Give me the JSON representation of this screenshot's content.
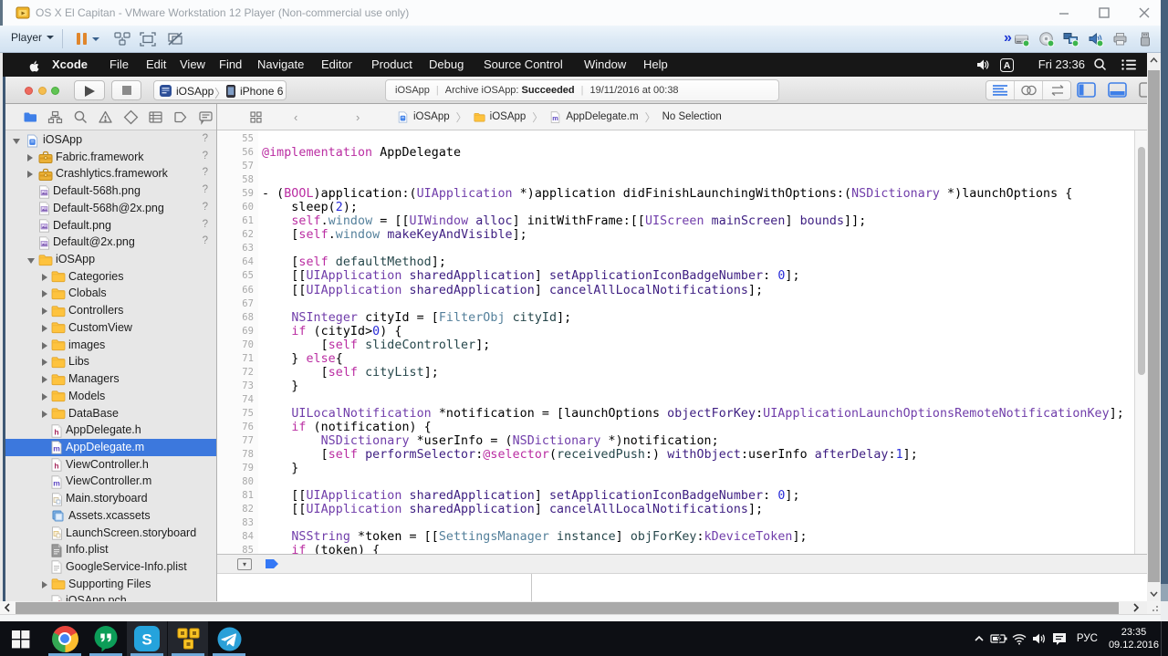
{
  "vmware": {
    "title": "OS X El Capitan - VMware Workstation 12 Player (Non-commercial use only)",
    "window_buttons": {
      "minimize": "–",
      "maximize": "",
      "close": "✕"
    },
    "player_menu_label": "Player",
    "toolbar_icons": [
      "pause",
      "ctrl-alt-del",
      "fullscreen",
      "unity"
    ],
    "overflow_chevrons": "»",
    "device_icons": [
      {
        "name": "hard-disk",
        "connected": true
      },
      {
        "name": "cd-rom",
        "connected": true
      },
      {
        "name": "network",
        "connected": true
      },
      {
        "name": "sound",
        "connected": true
      },
      {
        "name": "printer",
        "connected": false
      },
      {
        "name": "usb",
        "connected": false
      }
    ]
  },
  "macos": {
    "menus": [
      "Xcode",
      "File",
      "Edit",
      "View",
      "Find",
      "Navigate",
      "Editor",
      "Product",
      "Debug",
      "Source Control",
      "Window",
      "Help"
    ],
    "menu_extras": {
      "input_source": "A",
      "clock": "Fri 23:36"
    }
  },
  "xcode": {
    "toolbar": {
      "scheme": "iOSApp",
      "run_destination": "iPhone 6",
      "status_project": "iOSApp",
      "status_action": "Archive iOSApp:",
      "status_result": "Succeeded",
      "status_sep": "|",
      "status_date": "19/11/2016 at 00:38"
    },
    "navigator_tabs": [
      "project",
      "symbols",
      "search",
      "issues",
      "tests",
      "debug",
      "breakpoints",
      "reports"
    ],
    "navigator_items": [
      {
        "level": 0,
        "icon": "project",
        "label": "iOSApp",
        "badge": "?",
        "disclosure": "open"
      },
      {
        "level": 1,
        "icon": "framework",
        "label": "Fabric.framework",
        "badge": "?",
        "disclosure": "closed"
      },
      {
        "level": 1,
        "icon": "framework",
        "label": "Crashlytics.framework",
        "badge": "?",
        "disclosure": "closed"
      },
      {
        "level": 1,
        "icon": "png",
        "label": "Default-568h.png",
        "badge": "?"
      },
      {
        "level": 1,
        "icon": "png",
        "label": "Default-568h@2x.png",
        "badge": "?"
      },
      {
        "level": 1,
        "icon": "png",
        "label": "Default.png",
        "badge": "?"
      },
      {
        "level": 1,
        "icon": "png",
        "label": "Default@2x.png",
        "badge": "?"
      },
      {
        "level": 1,
        "icon": "folder",
        "label": "iOSApp",
        "disclosure": "open"
      },
      {
        "level": 2,
        "icon": "folder",
        "label": "Categories",
        "disclosure": "closed"
      },
      {
        "level": 2,
        "icon": "folder",
        "label": "Clobals",
        "disclosure": "closed"
      },
      {
        "level": 2,
        "icon": "folder",
        "label": "Controllers",
        "disclosure": "closed"
      },
      {
        "level": 2,
        "icon": "folder",
        "label": "CustomView",
        "disclosure": "closed"
      },
      {
        "level": 2,
        "icon": "folder",
        "label": "images",
        "disclosure": "closed"
      },
      {
        "level": 2,
        "icon": "folder",
        "label": "Libs",
        "disclosure": "closed"
      },
      {
        "level": 2,
        "icon": "folder",
        "label": "Managers",
        "disclosure": "closed"
      },
      {
        "level": 2,
        "icon": "folder",
        "label": "Models",
        "disclosure": "closed"
      },
      {
        "level": 2,
        "icon": "folder",
        "label": "DataBase",
        "disclosure": "closed"
      },
      {
        "level": 2,
        "icon": "file-h",
        "label": "AppDelegate.h"
      },
      {
        "level": 2,
        "icon": "file-m",
        "label": "AppDelegate.m",
        "selected": true
      },
      {
        "level": 2,
        "icon": "file-h",
        "label": "ViewController.h"
      },
      {
        "level": 2,
        "icon": "file-m",
        "label": "ViewController.m"
      },
      {
        "level": 2,
        "icon": "storyboard",
        "label": "Main.storyboard"
      },
      {
        "level": 2,
        "icon": "xcassets",
        "label": "Assets.xcassets"
      },
      {
        "level": 2,
        "icon": "storyboard2",
        "label": "LaunchScreen.storyboard"
      },
      {
        "level": 2,
        "icon": "plist",
        "label": "Info.plist"
      },
      {
        "level": 2,
        "icon": "plist2",
        "label": "GoogleService-Info.plist"
      },
      {
        "level": 2,
        "icon": "folder",
        "label": "Supporting Files",
        "disclosure": "closed"
      },
      {
        "level": 2,
        "icon": "pch",
        "label": "iOSApp.pch"
      }
    ],
    "jumpbar": {
      "crumbs": [
        {
          "icon": "project",
          "label": "iOSApp"
        },
        {
          "icon": "folder",
          "label": "iOSApp"
        },
        {
          "icon": "file-m",
          "label": "AppDelegate.m"
        },
        {
          "icon": null,
          "label": "No Selection"
        }
      ]
    },
    "editor_lines": [
      {
        "n": 55,
        "t": []
      },
      {
        "n": 56,
        "t": [
          [
            "k",
            "@implementation"
          ],
          [
            "p",
            " AppDelegate"
          ]
        ]
      },
      {
        "n": 57,
        "t": []
      },
      {
        "n": 58,
        "t": []
      },
      {
        "n": 59,
        "t": [
          [
            "p",
            "- ("
          ],
          [
            "k",
            "BOOL"
          ],
          [
            "p",
            ")application:("
          ],
          [
            "t",
            "UIApplication"
          ],
          [
            "p",
            " *)application didFinishLaunchingWithOptions:("
          ],
          [
            "t",
            "NSDictionary"
          ],
          [
            "p",
            " *)launchOptions {"
          ]
        ]
      },
      {
        "n": 60,
        "t": [
          [
            "p",
            "    sleep("
          ],
          [
            "n",
            "2"
          ],
          [
            "p",
            ");"
          ]
        ]
      },
      {
        "n": 61,
        "t": [
          [
            "p",
            "    "
          ],
          [
            "k",
            "self"
          ],
          [
            "p",
            "."
          ],
          [
            "w",
            "window"
          ],
          [
            "p",
            " = [["
          ],
          [
            "t",
            "UIWindow"
          ],
          [
            "p",
            " "
          ],
          [
            "m",
            "alloc"
          ],
          [
            "p",
            "] initWithFrame:[["
          ],
          [
            "t",
            "UIScreen"
          ],
          [
            "p",
            " "
          ],
          [
            "m",
            "mainScreen"
          ],
          [
            "p",
            "] "
          ],
          [
            "m",
            "bounds"
          ],
          [
            "p",
            "]];"
          ]
        ]
      },
      {
        "n": 62,
        "t": [
          [
            "p",
            "    ["
          ],
          [
            "k",
            "self"
          ],
          [
            "p",
            "."
          ],
          [
            "w",
            "window"
          ],
          [
            "p",
            " "
          ],
          [
            "m",
            "makeKeyAndVisible"
          ],
          [
            "p",
            "];"
          ]
        ]
      },
      {
        "n": 63,
        "t": []
      },
      {
        "n": 64,
        "t": [
          [
            "p",
            "    ["
          ],
          [
            "k",
            "self"
          ],
          [
            "p",
            " "
          ],
          [
            "f",
            "defaultMethod"
          ],
          [
            "p",
            "];"
          ]
        ]
      },
      {
        "n": 65,
        "t": [
          [
            "p",
            "    [["
          ],
          [
            "t",
            "UIApplication"
          ],
          [
            "p",
            " "
          ],
          [
            "m",
            "sharedApplication"
          ],
          [
            "p",
            "] "
          ],
          [
            "m",
            "setApplicationIconBadgeNumber"
          ],
          [
            "p",
            ": "
          ],
          [
            "n",
            "0"
          ],
          [
            "p",
            "];"
          ]
        ]
      },
      {
        "n": 66,
        "t": [
          [
            "p",
            "    [["
          ],
          [
            "t",
            "UIApplication"
          ],
          [
            "p",
            " "
          ],
          [
            "m",
            "sharedApplication"
          ],
          [
            "p",
            "] "
          ],
          [
            "m",
            "cancelAllLocalNotifications"
          ],
          [
            "p",
            "];"
          ]
        ]
      },
      {
        "n": 67,
        "t": []
      },
      {
        "n": 68,
        "t": [
          [
            "p",
            "    "
          ],
          [
            "t",
            "NSInteger"
          ],
          [
            "p",
            " cityId = ["
          ],
          [
            "c",
            "FilterObj"
          ],
          [
            "p",
            " "
          ],
          [
            "f",
            "cityId"
          ],
          [
            "p",
            "];"
          ]
        ]
      },
      {
        "n": 69,
        "t": [
          [
            "p",
            "    "
          ],
          [
            "k",
            "if"
          ],
          [
            "p",
            " (cityId>"
          ],
          [
            "n",
            "0"
          ],
          [
            "p",
            ") {"
          ]
        ]
      },
      {
        "n": 70,
        "t": [
          [
            "p",
            "        ["
          ],
          [
            "k",
            "self"
          ],
          [
            "p",
            " "
          ],
          [
            "f",
            "slideController"
          ],
          [
            "p",
            "];"
          ]
        ]
      },
      {
        "n": 71,
        "t": [
          [
            "p",
            "    } "
          ],
          [
            "k",
            "else"
          ],
          [
            "p",
            "{"
          ]
        ]
      },
      {
        "n": 72,
        "t": [
          [
            "p",
            "        ["
          ],
          [
            "k",
            "self"
          ],
          [
            "p",
            " "
          ],
          [
            "f",
            "cityList"
          ],
          [
            "p",
            "];"
          ]
        ]
      },
      {
        "n": 73,
        "t": [
          [
            "p",
            "    }"
          ]
        ]
      },
      {
        "n": 74,
        "t": []
      },
      {
        "n": 75,
        "t": [
          [
            "p",
            "    "
          ],
          [
            "t",
            "UILocalNotification"
          ],
          [
            "p",
            " *notification = [launchOptions "
          ],
          [
            "m",
            "objectForKey"
          ],
          [
            "p",
            ":"
          ],
          [
            "t",
            "UIApplicationLaunchOptionsRemoteNotificationKey"
          ],
          [
            "p",
            "];"
          ]
        ]
      },
      {
        "n": 76,
        "t": [
          [
            "p",
            "    "
          ],
          [
            "k",
            "if"
          ],
          [
            "p",
            " (notification) {"
          ]
        ]
      },
      {
        "n": 77,
        "t": [
          [
            "p",
            "        "
          ],
          [
            "t",
            "NSDictionary"
          ],
          [
            "p",
            " *userInfo = ("
          ],
          [
            "t",
            "NSDictionary"
          ],
          [
            "p",
            " *)notification;"
          ]
        ]
      },
      {
        "n": 78,
        "t": [
          [
            "p",
            "        ["
          ],
          [
            "k",
            "self"
          ],
          [
            "p",
            " "
          ],
          [
            "m",
            "performSelector"
          ],
          [
            "p",
            ":"
          ],
          [
            "k",
            "@selector"
          ],
          [
            "p",
            "("
          ],
          [
            "f",
            "receivedPush"
          ],
          [
            "p",
            ":) "
          ],
          [
            "m",
            "withObject"
          ],
          [
            "p",
            ":userInfo "
          ],
          [
            "m",
            "afterDelay"
          ],
          [
            "p",
            ":"
          ],
          [
            "n",
            "1"
          ],
          [
            "p",
            "];"
          ]
        ]
      },
      {
        "n": 79,
        "t": [
          [
            "p",
            "    }"
          ]
        ]
      },
      {
        "n": 80,
        "t": []
      },
      {
        "n": 81,
        "t": [
          [
            "p",
            "    [["
          ],
          [
            "t",
            "UIApplication"
          ],
          [
            "p",
            " "
          ],
          [
            "m",
            "sharedApplication"
          ],
          [
            "p",
            "] "
          ],
          [
            "m",
            "setApplicationIconBadgeNumber"
          ],
          [
            "p",
            ": "
          ],
          [
            "n",
            "0"
          ],
          [
            "p",
            "];"
          ]
        ]
      },
      {
        "n": 82,
        "t": [
          [
            "p",
            "    [["
          ],
          [
            "t",
            "UIApplication"
          ],
          [
            "p",
            " "
          ],
          [
            "m",
            "sharedApplication"
          ],
          [
            "p",
            "] "
          ],
          [
            "m",
            "cancelAllLocalNotifications"
          ],
          [
            "p",
            "];"
          ]
        ]
      },
      {
        "n": 83,
        "t": []
      },
      {
        "n": 84,
        "t": [
          [
            "p",
            "    "
          ],
          [
            "t",
            "NSString"
          ],
          [
            "p",
            " *token = [["
          ],
          [
            "c",
            "SettingsManager"
          ],
          [
            "p",
            " "
          ],
          [
            "f",
            "instance"
          ],
          [
            "p",
            "] "
          ],
          [
            "f",
            "objForKey"
          ],
          [
            "p",
            ":"
          ],
          [
            "t",
            "kDeviceToken"
          ],
          [
            "p",
            "];"
          ]
        ]
      },
      {
        "n": 85,
        "t": [
          [
            "p",
            "    "
          ],
          [
            "k",
            "if"
          ],
          [
            "p",
            " (token) {"
          ]
        ]
      }
    ]
  },
  "taskbar": {
    "apps": [
      {
        "icon": "start",
        "running": false,
        "active": false
      },
      {
        "icon": "chrome",
        "running": true,
        "active": false
      },
      {
        "icon": "hangouts",
        "running": true,
        "active": false
      },
      {
        "icon": "skype",
        "running": true,
        "active": true
      },
      {
        "icon": "vmware",
        "running": true,
        "active": true
      },
      {
        "icon": "telegram",
        "running": true,
        "active": false
      }
    ],
    "tray_icons": [
      "chevron-up",
      "battery",
      "wifi",
      "volume",
      "action-center"
    ],
    "language": "РУС",
    "time": "23:35",
    "date": "09.12.2016"
  }
}
